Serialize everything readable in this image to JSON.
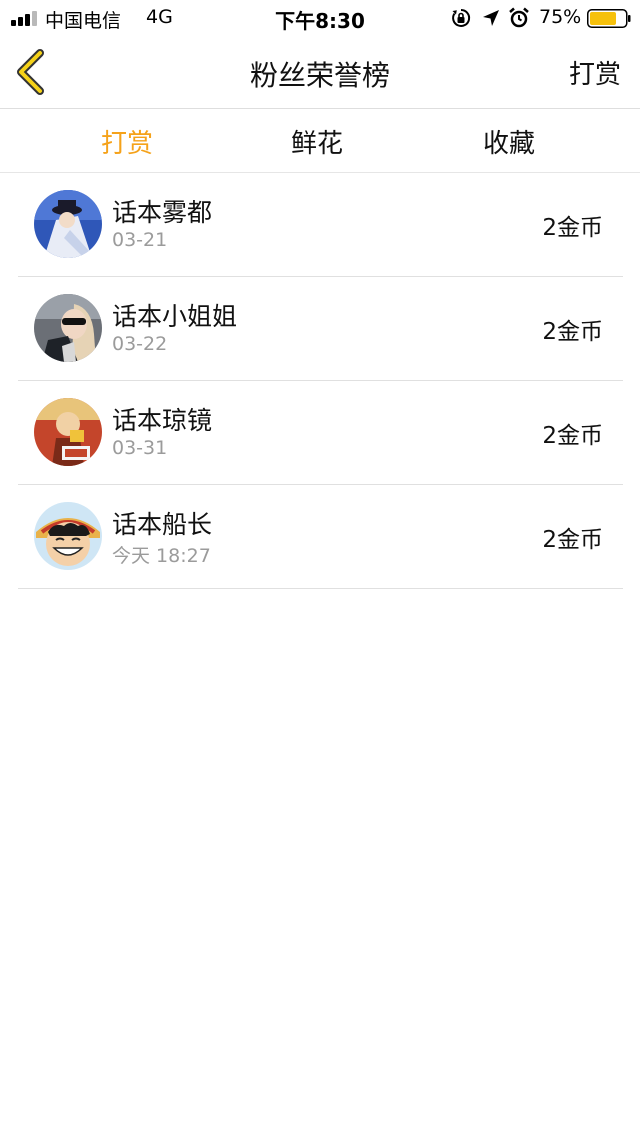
{
  "status_bar": {
    "carrier": "中国电信",
    "network": "4G",
    "time": "下午8:30",
    "battery": "75%",
    "battery_color": "#f6c10c"
  },
  "nav": {
    "back_icon": "chevron-left-icon",
    "title": "粉丝荣誉榜",
    "right_label": "打赏"
  },
  "tabs": [
    {
      "label": "打赏",
      "active": true
    },
    {
      "label": "鲜花",
      "active": false
    },
    {
      "label": "收藏",
      "active": false
    }
  ],
  "accent_color": "#f5a21a",
  "entries": [
    {
      "name": "话本雾都",
      "date": "03-21",
      "amount": "2金币"
    },
    {
      "name": "话本小姐姐",
      "date": "03-22",
      "amount": "2金币"
    },
    {
      "name": "话本琼镜",
      "date": "03-31",
      "amount": "2金币"
    },
    {
      "name": "话本船长",
      "date": "今天 18:27",
      "amount": "2金币"
    }
  ]
}
